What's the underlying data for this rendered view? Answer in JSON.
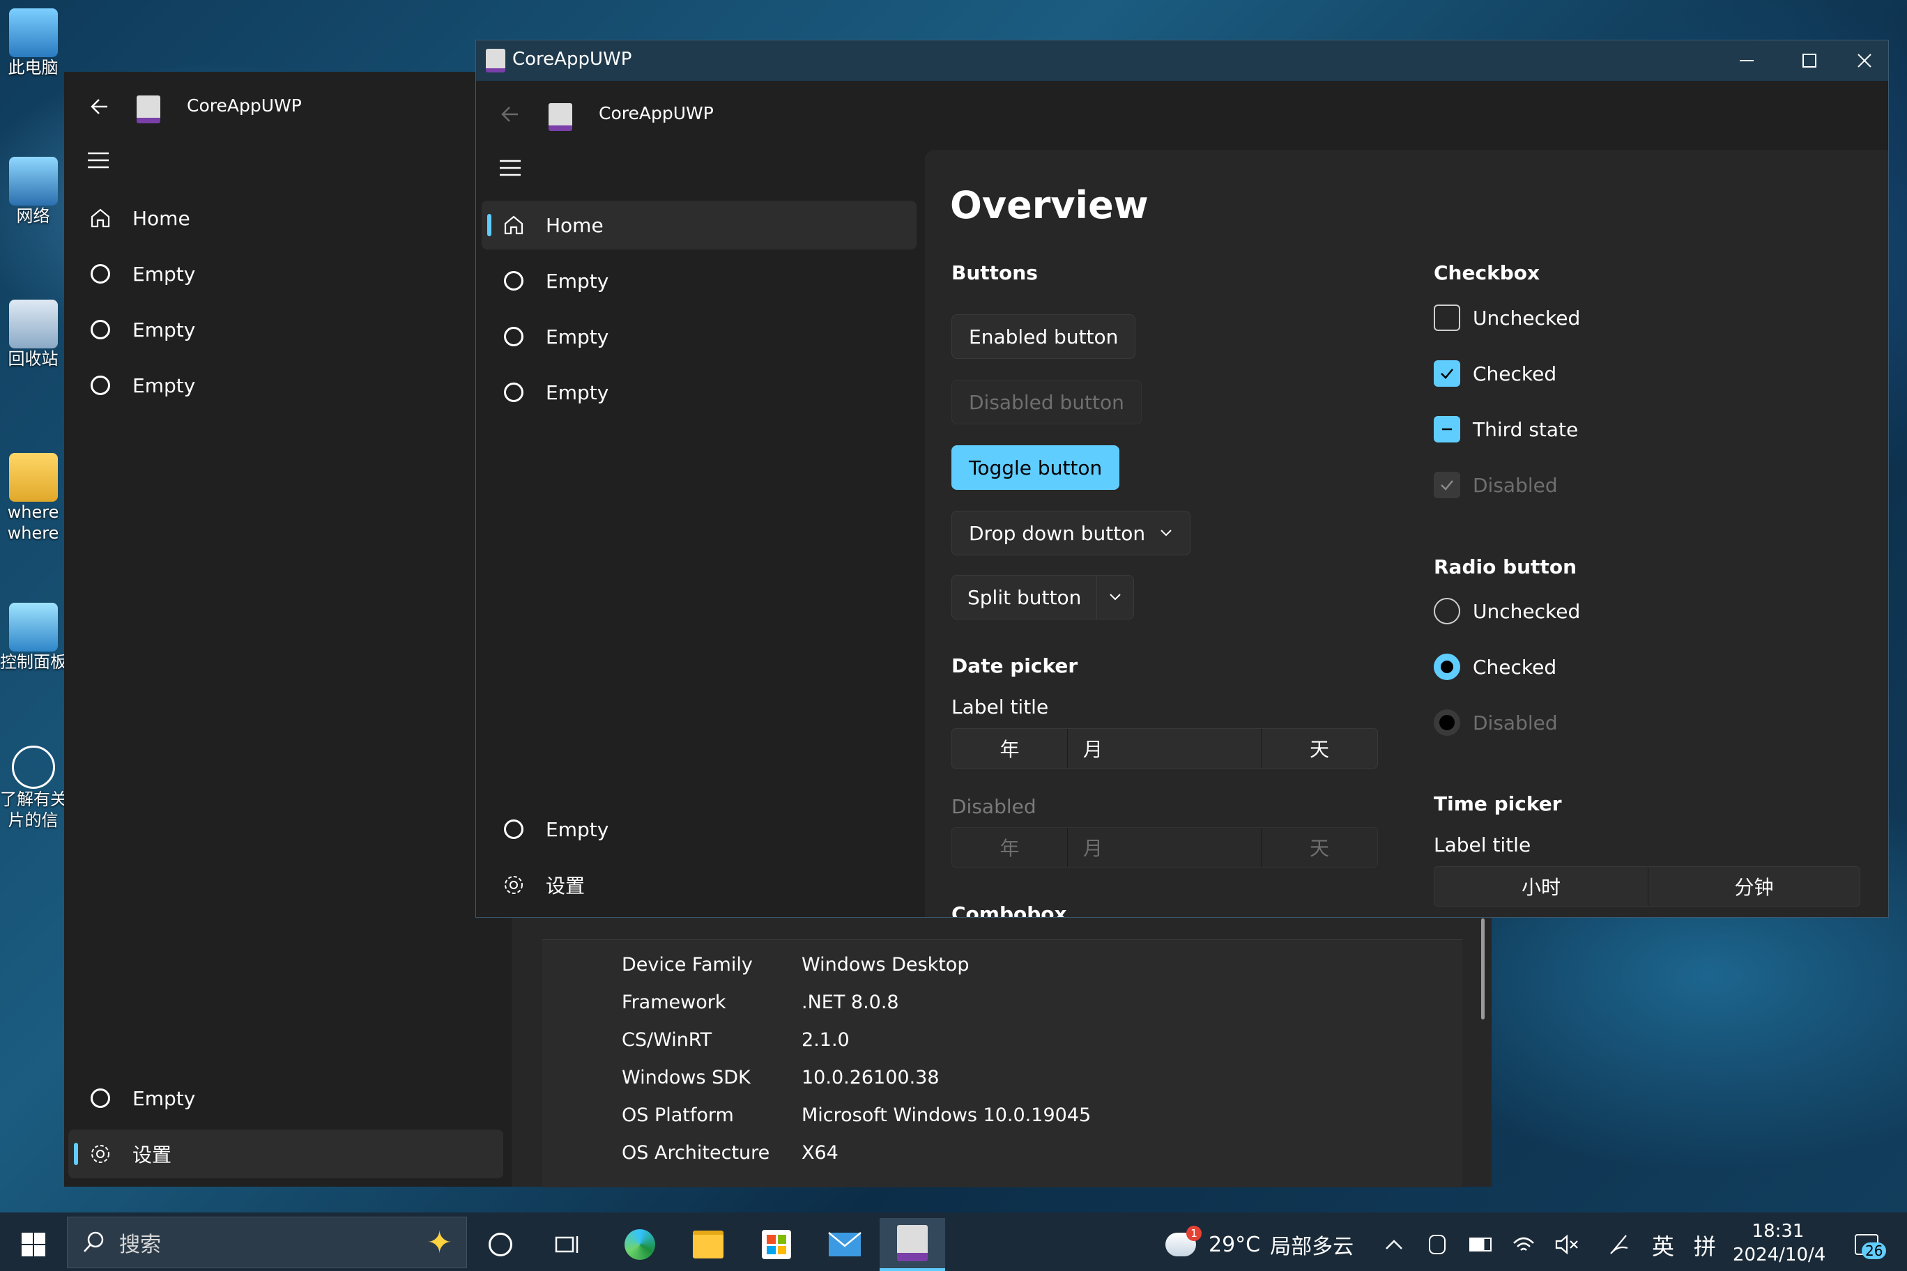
{
  "desktop": {
    "icons": [
      {
        "label": "此电脑"
      },
      {
        "label": "网络"
      },
      {
        "label": "回收站"
      },
      {
        "label": "where\nwhere"
      },
      {
        "label": "控制面板"
      },
      {
        "label": "了解有关\n片的信"
      }
    ]
  },
  "back_window": {
    "app_title": "CoreAppUWP",
    "nav": [
      "Home",
      "Empty",
      "Empty",
      "Empty"
    ],
    "footer_nav": [
      "Empty",
      "设置"
    ],
    "info": [
      {
        "key": "Device Family",
        "value": "Windows Desktop"
      },
      {
        "key": "Framework",
        "value": ".NET 8.0.8"
      },
      {
        "key": "CS/WinRT",
        "value": "2.1.0"
      },
      {
        "key": "Windows SDK",
        "value": "10.0.26100.38"
      },
      {
        "key": "OS Platform",
        "value": "Microsoft Windows 10.0.19045"
      },
      {
        "key": "OS Architecture",
        "value": "X64"
      }
    ]
  },
  "front_window": {
    "window_title": "CoreAppUWP",
    "app_title": "CoreAppUWP",
    "nav": [
      "Home",
      "Empty",
      "Empty",
      "Empty"
    ],
    "footer_nav": [
      "Empty",
      "设置"
    ],
    "page_title": "Overview",
    "buttons": {
      "section": "Buttons",
      "enabled": "Enabled button",
      "disabled": "Disabled button",
      "toggle": "Toggle button",
      "dropdown": "Drop down button",
      "split": "Split button"
    },
    "date_picker": {
      "section": "Date picker",
      "label": "Label title",
      "year": "年",
      "month": "月",
      "day": "天",
      "disabled_label": "Disabled"
    },
    "checkbox": {
      "section": "Checkbox",
      "unchecked": "Unchecked",
      "checked": "Checked",
      "third": "Third state",
      "disabled": "Disabled"
    },
    "radio": {
      "section": "Radio button",
      "unchecked": "Unchecked",
      "checked": "Checked",
      "disabled": "Disabled"
    },
    "time_picker": {
      "section": "Time picker",
      "label": "Label title",
      "hour": "小时",
      "minute": "分钟"
    },
    "cut_off_section": "Combobox"
  },
  "taskbar": {
    "search_placeholder": "搜索",
    "weather_temp": "29°C",
    "weather_text": "局部多云",
    "weather_badge": "1",
    "ime_lang": "英",
    "ime_mode": "拼",
    "time": "18:31",
    "date": "2024/10/4",
    "notif_count": "26"
  },
  "colors": {
    "accent": "#60cdff",
    "window_bg": "#202020",
    "content_bg": "#272727",
    "title_bar": "#1f3a4d"
  }
}
